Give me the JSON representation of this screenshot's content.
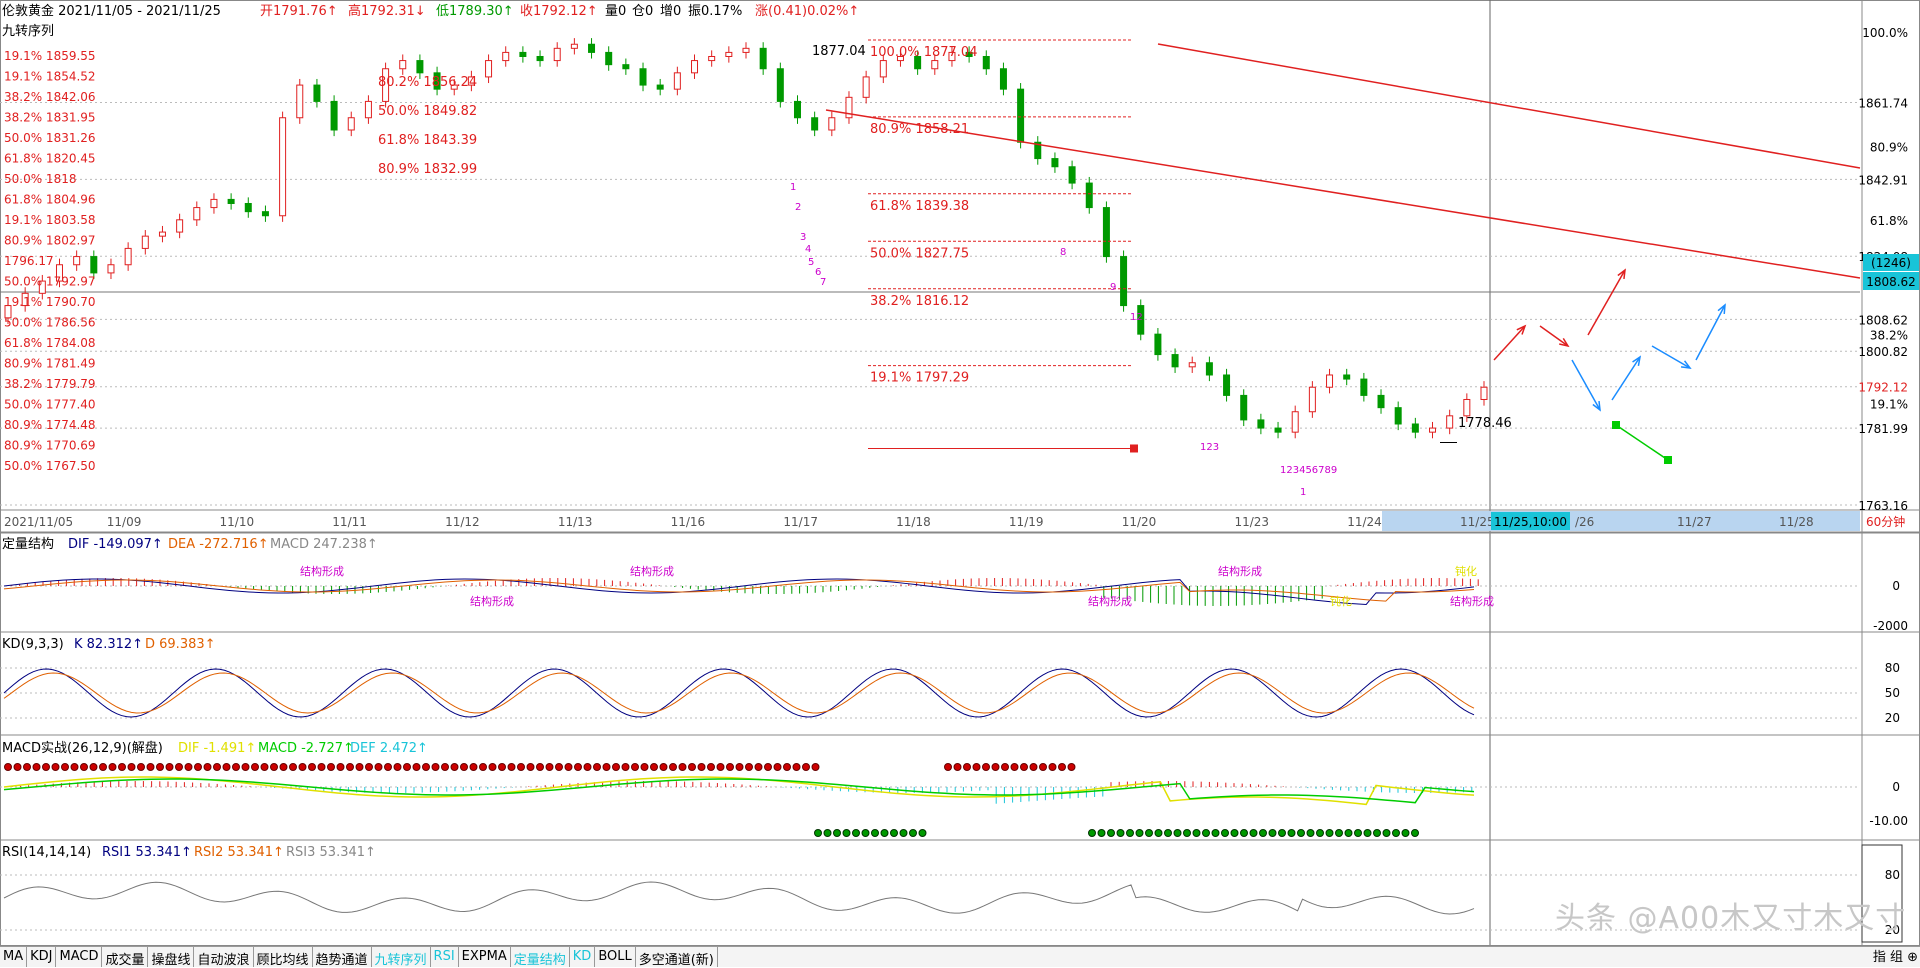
{
  "header": {
    "title": "伦敦黄金 2021/11/05 - 2021/11/25",
    "open": "开1791.76↑",
    "high": "高1792.31↓",
    "low": "低1789.30↑",
    "close": "收1792.12↑",
    "vol": "量0",
    "hold": "仓0",
    "inc": "增0",
    "amp": "振0.17%",
    "chg": "涨(0.41)0.02%↑"
  },
  "chart_data": {
    "type": "candlestick",
    "main": {
      "indicator_label": "九转序列",
      "y_ticks": [
        "1861.74",
        "1842.91",
        "1824.08",
        "1808.62",
        "1800.82",
        "1792.12",
        "1781.99",
        "1763.16"
      ],
      "pct_ticks": [
        "100.0%",
        "80.9%",
        "61.8%",
        "38.2%",
        "19.1%"
      ],
      "ylim": [
        1763.16,
        1877.04
      ],
      "price_box": "(1246)",
      "current_price": "1808.62",
      "x_labels": [
        "2021/11/05",
        "11/09",
        "11/10",
        "11/11",
        "11/12",
        "11/13",
        "11/16",
        "11/17",
        "11/18",
        "11/19",
        "11/20",
        "11/23",
        "11/24",
        "11/25"
      ],
      "x_future": [
        "/26",
        "11/27",
        "11/28"
      ],
      "cursor_time": "11/25,10:00",
      "period": "60分钟",
      "high_marker": "1877.04",
      "low_marker": "1778.46",
      "close_series": [
        1812,
        1815,
        1818,
        1822,
        1824,
        1820,
        1822,
        1826,
        1829,
        1830,
        1833,
        1836,
        1838,
        1837,
        1835,
        1834,
        1858,
        1866,
        1862,
        1855,
        1858,
        1862,
        1870,
        1872,
        1869,
        1865,
        1866,
        1868,
        1872,
        1874,
        1873,
        1872,
        1875,
        1876,
        1874,
        1871,
        1870,
        1866,
        1865,
        1869,
        1872,
        1873,
        1874,
        1875,
        1870,
        1862,
        1858,
        1855,
        1858,
        1863,
        1868,
        1872,
        1873,
        1870,
        1872,
        1874,
        1873,
        1870,
        1865,
        1852,
        1848,
        1846,
        1842,
        1836,
        1824,
        1812,
        1805,
        1800,
        1797,
        1798,
        1795,
        1790,
        1784,
        1782,
        1781,
        1786,
        1792,
        1795,
        1794,
        1790,
        1787,
        1783,
        1781,
        1782,
        1785,
        1789,
        1792
      ],
      "fib_levels": [
        {
          "pct": "100.0%",
          "price": "1877.04"
        },
        {
          "pct": "80.9%",
          "price": "1858.21"
        },
        {
          "pct": "61.8%",
          "price": "1839.38"
        },
        {
          "pct": "50.0%",
          "price": "1827.75"
        },
        {
          "pct": "38.2%",
          "price": "1816.12"
        },
        {
          "pct": "19.1%",
          "price": "1797.29"
        }
      ],
      "left_fib_labels": [
        "19.1% 1859.55",
        "19.1% 1854.52",
        "38.2% 1842.06",
        "38.2% 1831.95",
        "50.0% 1831.26",
        "61.8% 1820.45",
        "50.0% 1818",
        "61.8% 1804.96",
        "19.1% 1803.58",
        "80.9% 1802.97",
        "1796.17",
        "50.0% 1792.97",
        "19.1% 1790.70",
        "50.0% 1786.56",
        "61.8% 1784.08",
        "80.9% 1781.49",
        "38.2% 1779.79",
        "50.0% 1777.40",
        "80.9% 1774.48",
        "80.9% 1770.69",
        "50.0% 1767.50"
      ],
      "mid_fib_labels": [
        "80.2% 1856.24",
        "50.0% 1849.82",
        "61.8% 1843.39",
        "80.9% 1832.99"
      ],
      "td_numbers": [
        "1",
        "2",
        "3",
        "4",
        "5",
        "6",
        "7",
        "8",
        "9",
        "12",
        "123",
        "123456789"
      ]
    },
    "macd": {
      "title": "定量结构",
      "dif": "DIF -149.097↑",
      "dea": "DEA -272.716↑",
      "macd": "MACD 247.238↑",
      "y_ticks": [
        "0",
        "-2000"
      ],
      "annotations": [
        "结构形成",
        "结构形成",
        "结构形成",
        "结构形成",
        "结构形成",
        "钝化",
        "钝化",
        "结构形成"
      ]
    },
    "kd": {
      "title": "KD(9,3,3)",
      "k": "K 82.312↑",
      "d": "D 69.383↑",
      "y_ticks": [
        "80",
        "50",
        "20"
      ]
    },
    "macd2": {
      "title": "MACD实战(26,12,9)(解盘)",
      "dif": "DIF -1.491↑",
      "macd": "MACD -2.727↑",
      "def": "DEF 2.472↑",
      "y_ticks": [
        "0",
        "-10.00"
      ]
    },
    "rsi": {
      "title": "RSI(14,14,14)",
      "rsi1": "RSI1 53.341↑",
      "rsi2": "RSI2 53.341↑",
      "rsi3": "RSI3 53.341↑",
      "y_ticks": [
        "80",
        "20"
      ]
    },
    "colors": {
      "up": "#e02020",
      "down": "#009900",
      "dif_line": "#000080",
      "dea_line": "#e06000",
      "yellow": "#ffff00",
      "magenta": "#cc00cc",
      "cyan": "#19c4d8",
      "blue_arrow": "#1a8cff"
    }
  },
  "tabs": [
    "MA",
    "KDJ",
    "MACD",
    "成交量",
    "操盘线",
    "自动波浪",
    "顾比均线",
    "趋势通道",
    "九转序列",
    "RSI",
    "EXPMA",
    "定量结构",
    "KD",
    "BOLL",
    "多空通道(新)"
  ],
  "active_tabs": [
    "九转序列",
    "RSI",
    "定量结构",
    "KD"
  ],
  "corner": "指 组 ⊕",
  "watermark": "头条 @A00木又寸木又寸"
}
